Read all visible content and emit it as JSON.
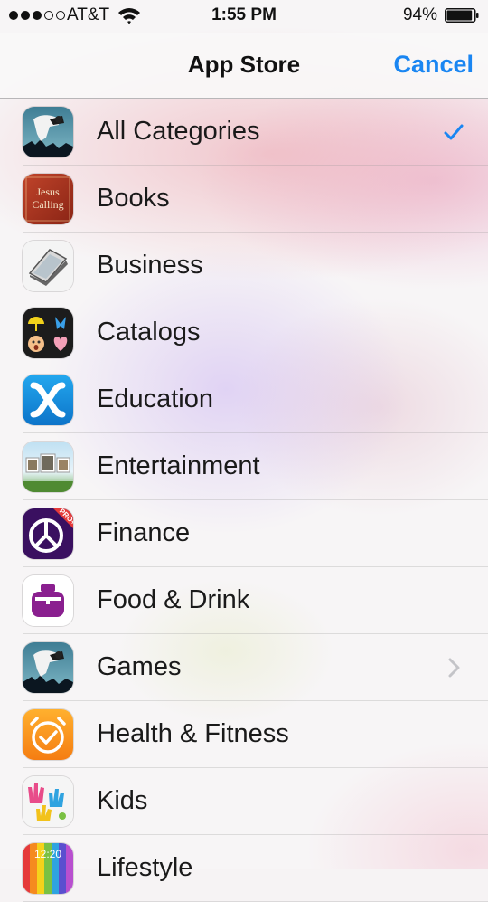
{
  "status_bar": {
    "carrier": "AT&T",
    "time": "1:55 PM",
    "battery_percent": "94%",
    "battery_level": 0.94,
    "signal_strength": 3,
    "signal_max": 5
  },
  "navbar": {
    "title": "App Store",
    "cancel_label": "Cancel"
  },
  "colors": {
    "accent": "#1a86f2"
  },
  "categories": [
    {
      "label": "All Categories",
      "accessory": "checkmark-icon",
      "selected": true
    },
    {
      "label": "Books",
      "icon_text_line1": "Jesus",
      "icon_text_line2": "Calling"
    },
    {
      "label": "Business"
    },
    {
      "label": "Catalogs"
    },
    {
      "label": "Education"
    },
    {
      "label": "Entertainment"
    },
    {
      "label": "Finance",
      "icon_badge": "PRO+"
    },
    {
      "label": "Food & Drink"
    },
    {
      "label": "Games",
      "accessory": "chevron-right-icon"
    },
    {
      "label": "Health & Fitness"
    },
    {
      "label": "Kids"
    },
    {
      "label": "Lifestyle",
      "icon_text": "12:20"
    }
  ]
}
